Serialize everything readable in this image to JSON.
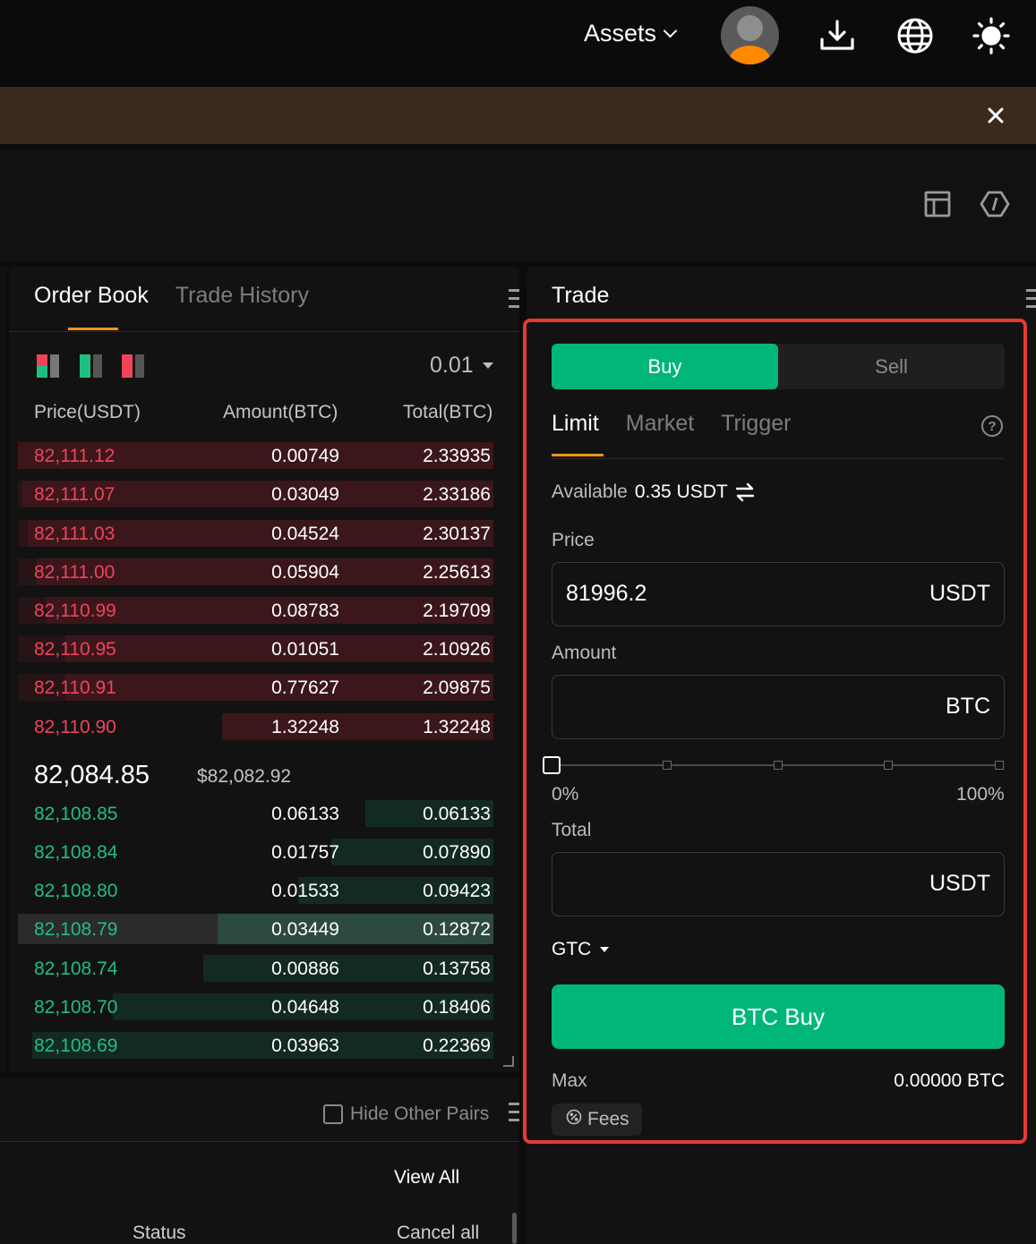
{
  "topbar": {
    "assets_label": "Assets"
  },
  "colors": {
    "buy_green": "#00b67a",
    "ask_red": "#f0435a",
    "bid_green": "#1fbf84",
    "accent_orange": "#f7931a",
    "banner_brown": "#3b2a1c",
    "highlight_red": "#e53935"
  },
  "order_book": {
    "tabs": [
      "Order Book",
      "Trade History"
    ],
    "active_tab": "Order Book",
    "step": "0.01",
    "columns": [
      "Price(USDT)",
      "Amount(BTC)",
      "Total(BTC)"
    ],
    "asks": [
      {
        "price": "82,111.12",
        "amount": "0.00749",
        "total": "2.33935",
        "depth": 1.0
      },
      {
        "price": "82,111.07",
        "amount": "0.03049",
        "total": "2.33186",
        "depth": 0.99
      },
      {
        "price": "82,111.03",
        "amount": "0.04524",
        "total": "2.30137",
        "depth": 0.98
      },
      {
        "price": "82,111.00",
        "amount": "0.05904",
        "total": "2.25613",
        "depth": 0.96
      },
      {
        "price": "82,110.99",
        "amount": "0.08783",
        "total": "2.19709",
        "depth": 0.94
      },
      {
        "price": "82,110.95",
        "amount": "0.01051",
        "total": "2.10926",
        "depth": 0.9
      },
      {
        "price": "82,110.91",
        "amount": "0.77627",
        "total": "2.09875",
        "depth": 0.9
      },
      {
        "price": "82,110.90",
        "amount": "1.32248",
        "total": "1.32248",
        "depth": 0.57
      }
    ],
    "mid_price": "82,084.85",
    "mid_usd": "$82,082.92",
    "bids": [
      {
        "price": "82,108.85",
        "amount": "0.06133",
        "total": "0.06133",
        "depth": 0.27
      },
      {
        "price": "82,108.84",
        "amount": "0.01757",
        "total": "0.07890",
        "depth": 0.34
      },
      {
        "price": "82,108.80",
        "amount": "0.01533",
        "total": "0.09423",
        "depth": 0.41
      },
      {
        "price": "82,108.79",
        "amount": "0.03449",
        "total": "0.12872",
        "depth": 0.58
      },
      {
        "price": "82,108.74",
        "amount": "0.00886",
        "total": "0.13758",
        "depth": 0.61
      },
      {
        "price": "82,108.70",
        "amount": "0.04648",
        "total": "0.18406",
        "depth": 0.8
      },
      {
        "price": "82,108.69",
        "amount": "0.03963",
        "total": "0.22369",
        "depth": 0.97
      }
    ]
  },
  "orders": {
    "hide_other_pairs": "Hide Other Pairs",
    "view_all": "View All",
    "status_col": "Status",
    "cancel_all": "Cancel all"
  },
  "trade": {
    "title": "Trade",
    "buy_label": "Buy",
    "sell_label": "Sell",
    "order_tabs": [
      "Limit",
      "Market",
      "Trigger"
    ],
    "active_order_tab": "Limit",
    "help": "?",
    "available_label": "Available",
    "available_value": "0.35 USDT",
    "price_label": "Price",
    "price_value": "81996.2",
    "price_unit": "USDT",
    "amount_label": "Amount",
    "amount_value": "",
    "amount_unit": "BTC",
    "slider_min": "0%",
    "slider_max": "100%",
    "slider_value": 0,
    "total_label": "Total",
    "total_value": "",
    "total_unit": "USDT",
    "time_in_force": "GTC",
    "submit_label": "BTC Buy",
    "max_label": "Max",
    "max_value": "0.00000 BTC",
    "fees_label": "Fees"
  }
}
